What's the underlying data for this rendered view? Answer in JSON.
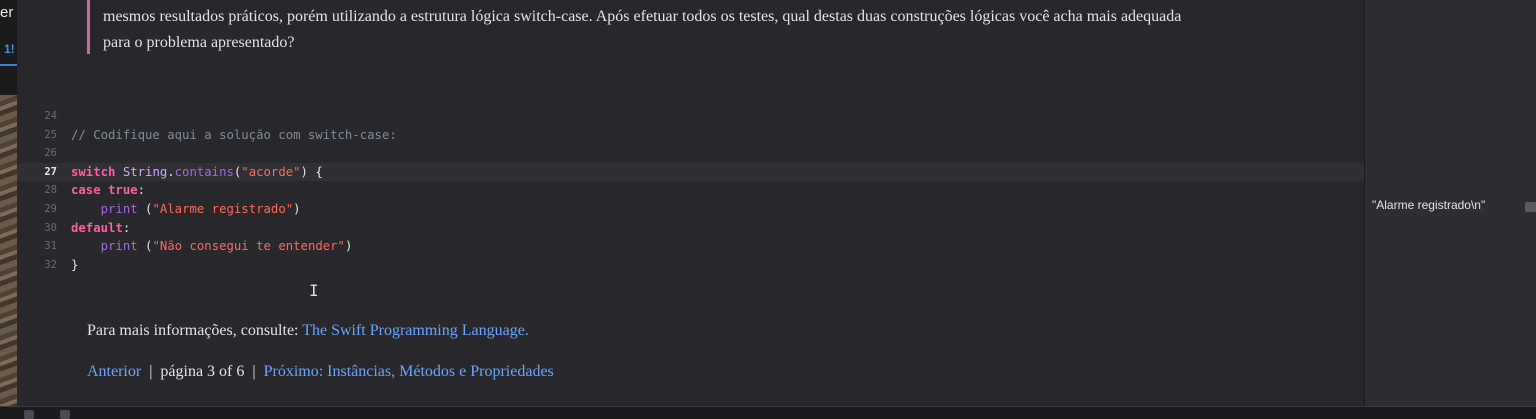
{
  "sidebar_sliver": {
    "text": "er",
    "number": "1!"
  },
  "callout": {
    "line1": "mesmos resultados práticos, porém utilizando a estrutura lógica switch-case. Após efetuar todos os testes, qual destas duas construções lógicas você acha mais adequada",
    "line2": "para o problema apresentado?"
  },
  "code": {
    "active_line": "27",
    "lines": [
      {
        "num": "24",
        "tokens": []
      },
      {
        "num": "25",
        "tokens": [
          {
            "t": "cm",
            "v": "// Codifique aqui a solução com switch-case:"
          }
        ]
      },
      {
        "num": "26",
        "tokens": []
      },
      {
        "num": "27",
        "tokens": [
          {
            "t": "kw",
            "v": "switch"
          },
          {
            "t": "plain",
            "v": " "
          },
          {
            "t": "type",
            "v": "String"
          },
          {
            "t": "plain",
            "v": "."
          },
          {
            "t": "fn",
            "v": "contains"
          },
          {
            "t": "plain",
            "v": "("
          },
          {
            "t": "str",
            "v": "\"acorde\""
          },
          {
            "t": "plain",
            "v": ") {"
          }
        ]
      },
      {
        "num": "28",
        "tokens": [
          {
            "t": "kw",
            "v": "case"
          },
          {
            "t": "plain",
            "v": " "
          },
          {
            "t": "kw",
            "v": "true"
          },
          {
            "t": "plain",
            "v": ":"
          }
        ]
      },
      {
        "num": "29",
        "tokens": [
          {
            "t": "plain",
            "v": "    "
          },
          {
            "t": "fn",
            "v": "print"
          },
          {
            "t": "plain",
            "v": " ("
          },
          {
            "t": "str",
            "v": "\"Alarme registrado\""
          },
          {
            "t": "plain",
            "v": ")"
          }
        ]
      },
      {
        "num": "30",
        "tokens": [
          {
            "t": "kw",
            "v": "default"
          },
          {
            "t": "plain",
            "v": ":"
          }
        ]
      },
      {
        "num": "31",
        "tokens": [
          {
            "t": "plain",
            "v": "    "
          },
          {
            "t": "fn",
            "v": "print"
          },
          {
            "t": "plain",
            "v": " ("
          },
          {
            "t": "str",
            "v": "\"Não consegui te entender\""
          },
          {
            "t": "plain",
            "v": ")"
          }
        ]
      },
      {
        "num": "32",
        "tokens": [
          {
            "t": "plain",
            "v": "}"
          }
        ]
      }
    ]
  },
  "info": {
    "prefix": "Para mais informações, consulte: ",
    "link": "The Swift Programming Language."
  },
  "pager": {
    "previous": "Anterior",
    "page": "página 3 of 6",
    "next": "Próximo: Instâncias, Métodos e Propriedades"
  },
  "results": {
    "value": "\"Alarme registrado\\n\""
  },
  "colors": {
    "callout_border": "#d2679f",
    "link": "#6aa4ff",
    "keyword": "#fc5fa3",
    "string": "#fc6a5d"
  }
}
